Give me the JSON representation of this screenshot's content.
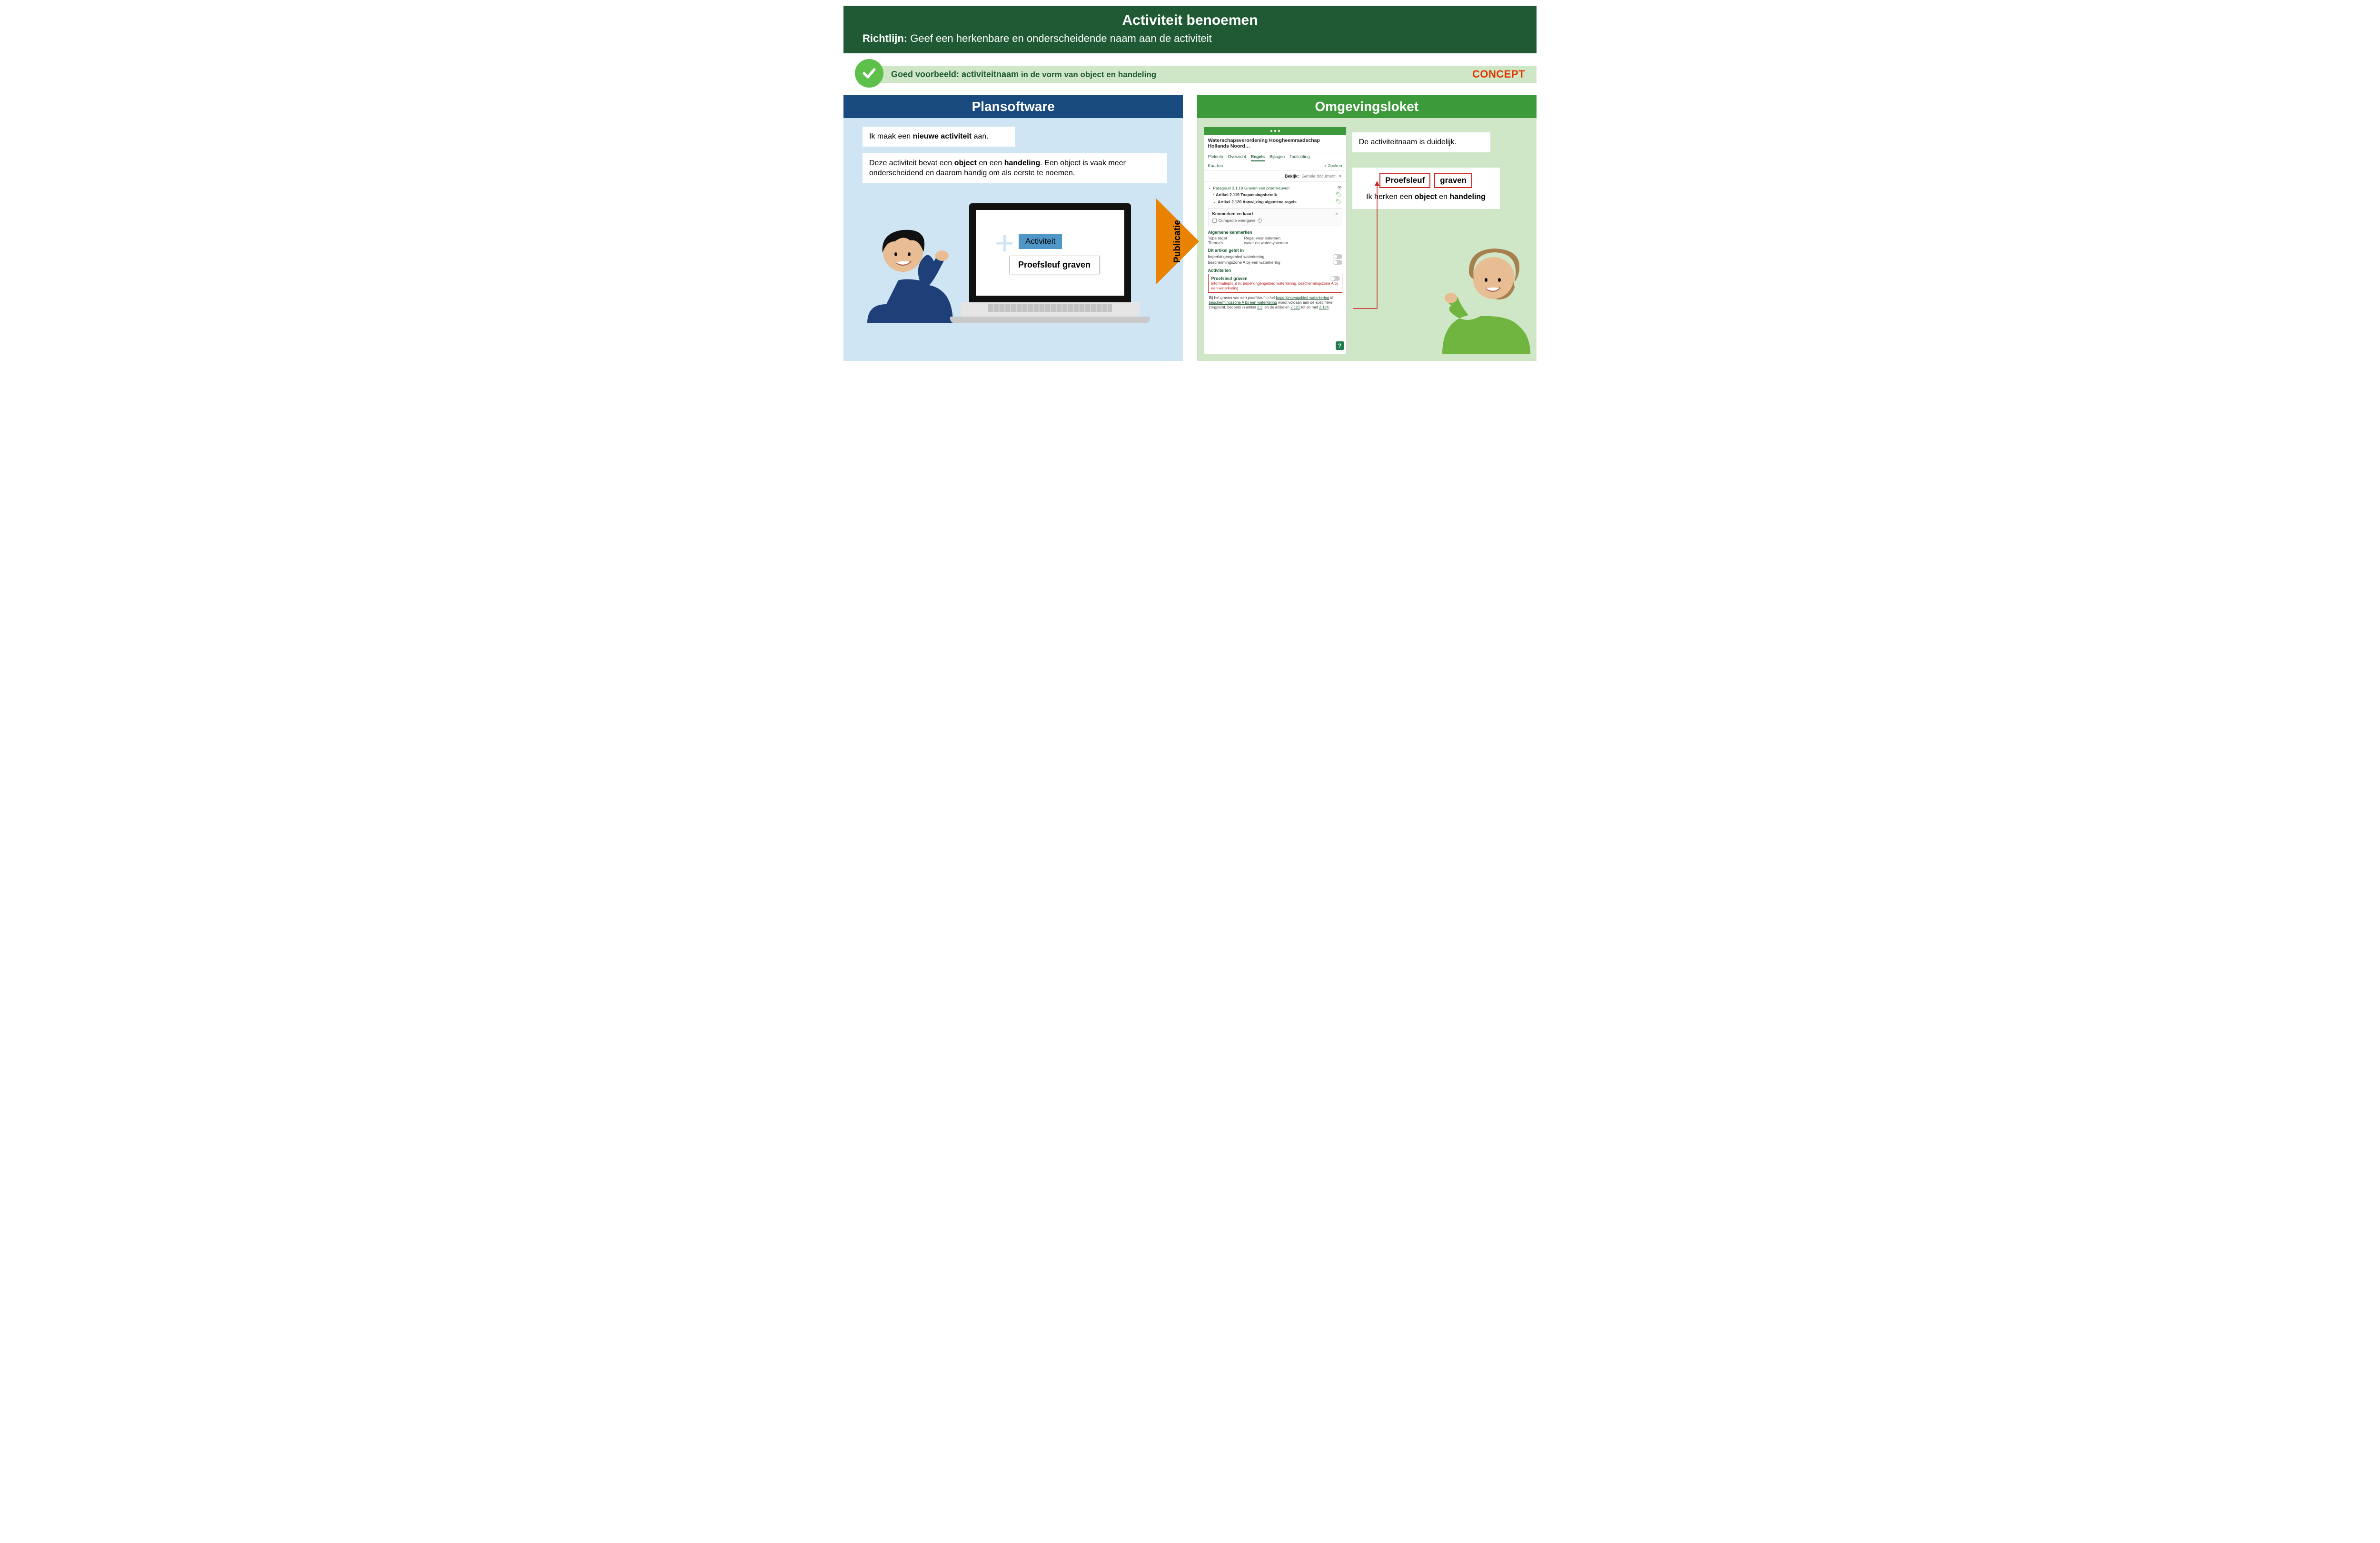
{
  "banner": {
    "title": "Activiteit benoemen",
    "sub_bold": "Richtlijn:",
    "sub_rest": " Geef een herkenbare en onderscheidende naam aan de activiteit"
  },
  "goodbar": {
    "lead": "Goed voorbeeld: ",
    "bold": "activiteitnaam",
    "rest": " in de vorm van object en handeling",
    "concept": "CONCEPT"
  },
  "left": {
    "heading": "Plansoftware",
    "bubble1_pre": "Ik maak een ",
    "bubble1_bold": "nieuwe activiteit",
    "bubble1_post": " aan.",
    "bubble2_pre": "Deze activiteit bevat een ",
    "bubble2_b1": "object",
    "bubble2_mid": " en een ",
    "bubble2_b2": "handeling",
    "bubble2_post": ". Een object is vaak meer onderscheidend en daarom handig om als eerste te noemen.",
    "chip_blue": "Activiteit",
    "chip_white": "Proefsleuf graven"
  },
  "arrow_label": "Publicatie",
  "right": {
    "heading": "Omgevingsloket",
    "bubble1": "De activiteitnaam is duidelijk.",
    "chip1": "Proefsleuf",
    "chip2": "graven",
    "bubble2_pre": "Ik herken een ",
    "bubble2_b1": "object",
    "bubble2_mid": " en ",
    "bubble2_b2": "handeling"
  },
  "browser": {
    "title": "Waterschapsverordening Hoogheemraadschap Hollands Noord…",
    "tabs": [
      "Plekinfo",
      "Overzicht",
      "Regels",
      "Bijlagen",
      "Toelichting"
    ],
    "active_tab_index": 2,
    "kaarten": "Kaarten",
    "zoeken": "Zoeken",
    "bekijk_label": "Bekijk:",
    "bekijk_value": "Gehele document",
    "tree": {
      "p": "Paragraaf 2.1.19 Graven van proefsleuven",
      "a1": "Artikel 2.119 Toepassingsbereik",
      "a2": "Artikel 2.120 Aanwijzing algemene regels"
    },
    "kk": {
      "head": "Kenmerken en kaart",
      "check": "Compacte weergave"
    },
    "alg": {
      "head": "Algemene kenmerken",
      "k1": "Type regel",
      "v1": "Regel voor iedereen",
      "k2": "Thema's",
      "v2": "water en watersystemen"
    },
    "geldt": {
      "head": "Dit artikel geldt in",
      "r1": "beperkingengebied waterkering",
      "r2": "beschermingszone A bij een waterkering"
    },
    "act": {
      "head": "Activiteiten",
      "name": "Proefsleuf graven",
      "sub": "informatieplicht in: beperkingengebied waterkering, beschermingszone A bij een waterkering"
    },
    "footnote_1": "Bij het graven van een proefsleuf in het ",
    "footnote_l1": "beperkingengebied waterkering",
    "footnote_2": " of ",
    "footnote_l2": "beschermingszone A bij een waterkering",
    "footnote_3": " wordt voldaan aan de specifieke zorgplicht, bedoeld in artikel ",
    "footnote_l3": "2.3",
    "footnote_4": ", en de artikelen ",
    "footnote_l4": "2.121",
    "footnote_5": " tot en met ",
    "footnote_l5": "2.124",
    "footnote_6": "."
  }
}
